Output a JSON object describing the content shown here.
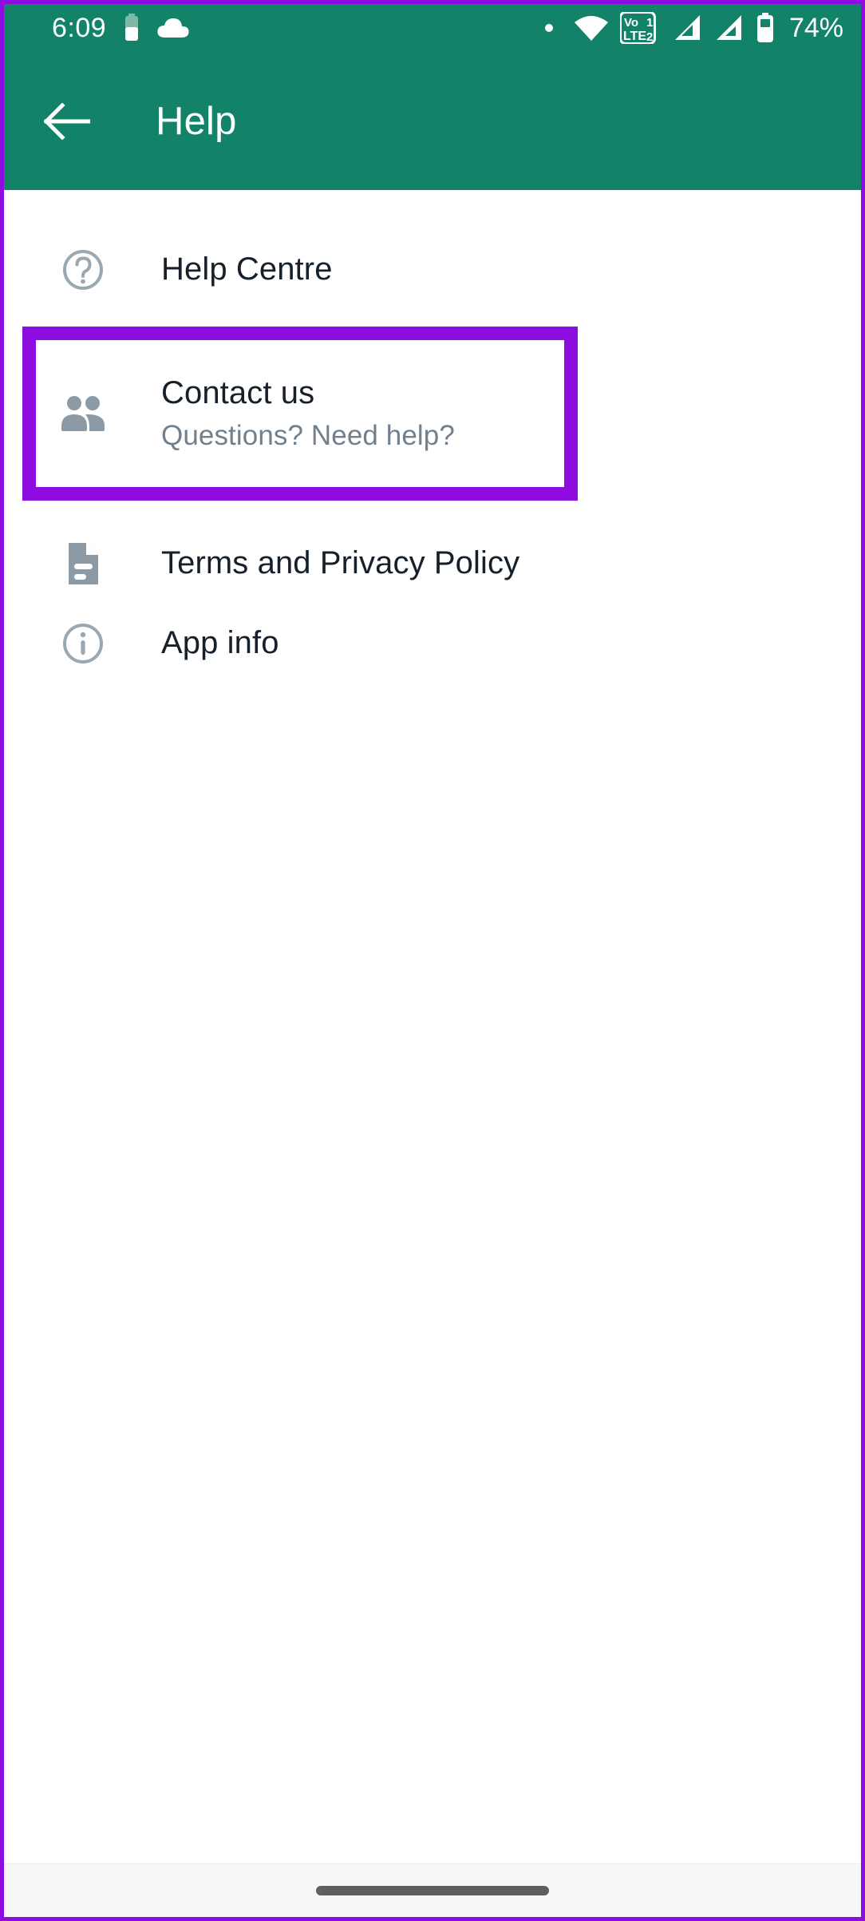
{
  "status_bar": {
    "time": "6:09",
    "battery_percent": "74%",
    "icons": [
      "battery-saver-icon",
      "cloud-icon",
      "dot-indicator-icon",
      "wifi-icon",
      "volte-sim1-icon",
      "signal-sim1-icon",
      "signal-sim2-icon",
      "battery-icon"
    ],
    "volte_label_top": "VoLTE",
    "sim1_label": "1",
    "sim2_label": "2"
  },
  "app_bar": {
    "title": "Help",
    "back_icon": "arrow-back-icon"
  },
  "list": {
    "items": [
      {
        "id": "help-centre",
        "icon": "help-circle-icon",
        "title": "Help Centre",
        "subtitle": ""
      },
      {
        "id": "contact-us",
        "icon": "people-icon",
        "title": "Contact us",
        "subtitle": "Questions? Need help?"
      },
      {
        "id": "terms-and-privacy-policy",
        "icon": "document-icon",
        "title": "Terms and Privacy Policy",
        "subtitle": ""
      },
      {
        "id": "app-info",
        "icon": "info-circle-icon",
        "title": "App info",
        "subtitle": ""
      }
    ]
  },
  "annotation": {
    "target": "contact-us",
    "color": "#8f0ce0"
  },
  "nav_bar": {
    "gesture_pill": "home-gesture-pill"
  },
  "colors": {
    "app_bar_green": "#128368",
    "highlight_purple": "#8f0ce0",
    "title_text": "#16202a",
    "subtitle_text": "#71808c",
    "icon_grey": "#8b9aa5",
    "nav_bar_bg": "#f6f7f9"
  }
}
